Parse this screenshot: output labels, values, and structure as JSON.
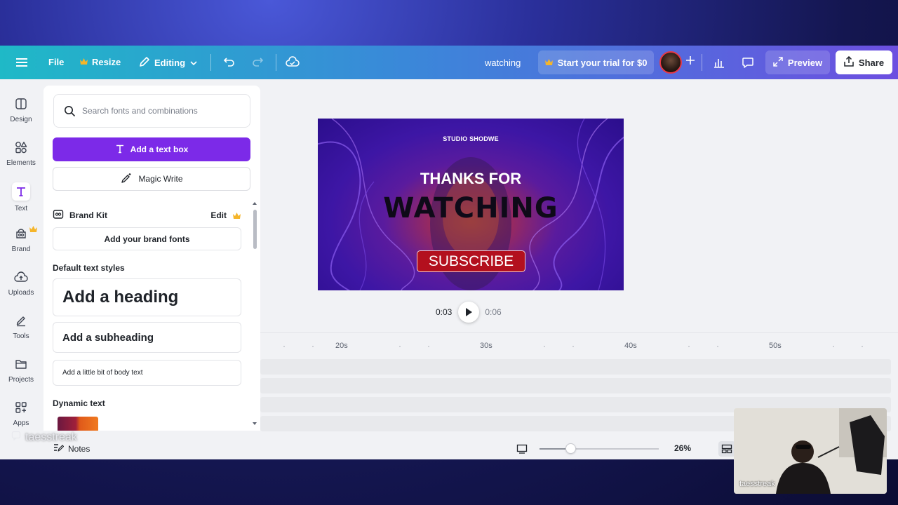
{
  "topbar": {
    "file": "File",
    "resize": "Resize",
    "editing": "Editing",
    "doc_title": "watching",
    "trial": "Start your trial for $0",
    "preview": "Preview",
    "share": "Share"
  },
  "rail": {
    "items": [
      {
        "label": "Design",
        "icon": "layout-icon"
      },
      {
        "label": "Elements",
        "icon": "shapes-icon"
      },
      {
        "label": "Text",
        "icon": "text-icon"
      },
      {
        "label": "Brand",
        "icon": "brand-icon"
      },
      {
        "label": "Uploads",
        "icon": "upload-icon"
      },
      {
        "label": "Tools",
        "icon": "pen-icon"
      },
      {
        "label": "Projects",
        "icon": "folder-icon"
      },
      {
        "label": "Apps",
        "icon": "apps-icon"
      }
    ]
  },
  "panel": {
    "search_placeholder": "Search fonts and combinations",
    "add_text_box": "Add a text box",
    "magic_write": "Magic Write",
    "brand_kit": "Brand Kit",
    "edit": "Edit",
    "add_brand_fonts": "Add your brand fonts",
    "default_styles_title": "Default text styles",
    "heading": "Add a heading",
    "subheading": "Add a subheading",
    "body": "Add a little bit of body text",
    "dynamic_text_title": "Dynamic text"
  },
  "slide": {
    "studio": "STUDIO SHODWE",
    "thanks": "THANKS FOR",
    "watching": "WATCHING",
    "subscribe": "SUBSCRIBE"
  },
  "playback": {
    "current": "0:03",
    "total": "0:06"
  },
  "timeline": {
    "ticks": [
      "20s",
      "30s",
      "40s",
      "50s"
    ]
  },
  "bottom": {
    "notes": "Notes",
    "zoom": "26%",
    "zoom_level": 0.26
  },
  "overlay": {
    "watermark": "taesstreak",
    "cam_label": "taesstreak"
  },
  "colors": {
    "accent_purple": "#7c2ae8",
    "topbar_start": "#1fb9c7",
    "topbar_end": "#6c4fe0",
    "subscribe_red": "#b3101e",
    "crown_gold": "#f5b52a"
  }
}
